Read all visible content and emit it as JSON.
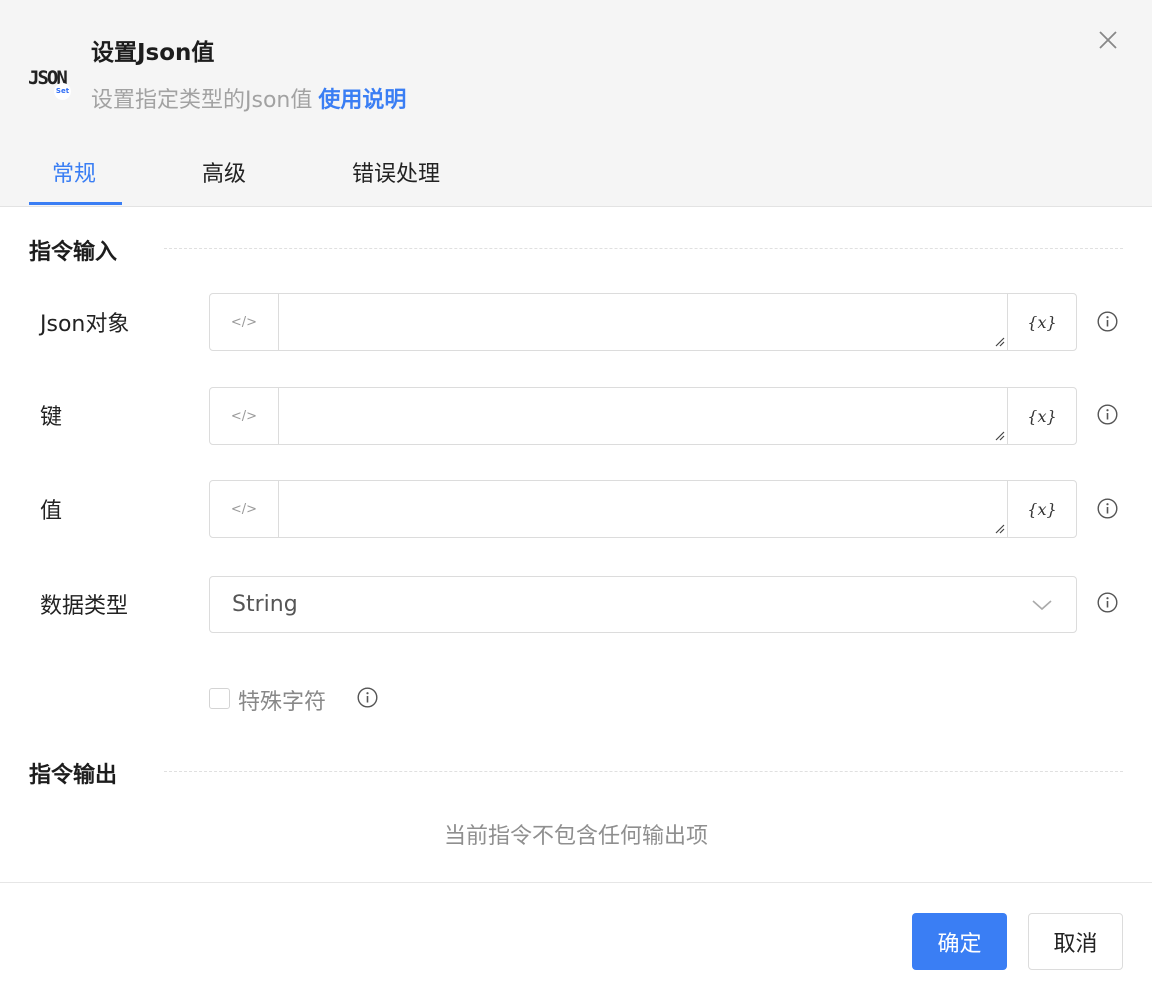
{
  "header": {
    "logo_text": "JSON",
    "logo_badge": "Set",
    "title": "设置Json值",
    "subtitle": "设置指定类型的Json值",
    "help_link": "使用说明"
  },
  "tabs": [
    {
      "label": "常规",
      "active": true
    },
    {
      "label": "高级",
      "active": false
    },
    {
      "label": "错误处理",
      "active": false
    }
  ],
  "input_section": {
    "title": "指令输入",
    "fields": [
      {
        "label": "Json对象",
        "value": "",
        "var_label": "{x}"
      },
      {
        "label": "键",
        "value": "",
        "var_label": "{x}"
      },
      {
        "label": "值",
        "value": "",
        "var_label": "{x}"
      }
    ],
    "data_type": {
      "label": "数据类型",
      "value": "String"
    },
    "special_chars": {
      "label": "特殊字符",
      "checked": false
    }
  },
  "output_section": {
    "title": "指令输出",
    "empty_text": "当前指令不包含任何输出项"
  },
  "footer": {
    "ok_label": "确定",
    "cancel_label": "取消"
  },
  "colors": {
    "accent": "#3a7ef4",
    "header_bg": "#f5f5f5"
  }
}
